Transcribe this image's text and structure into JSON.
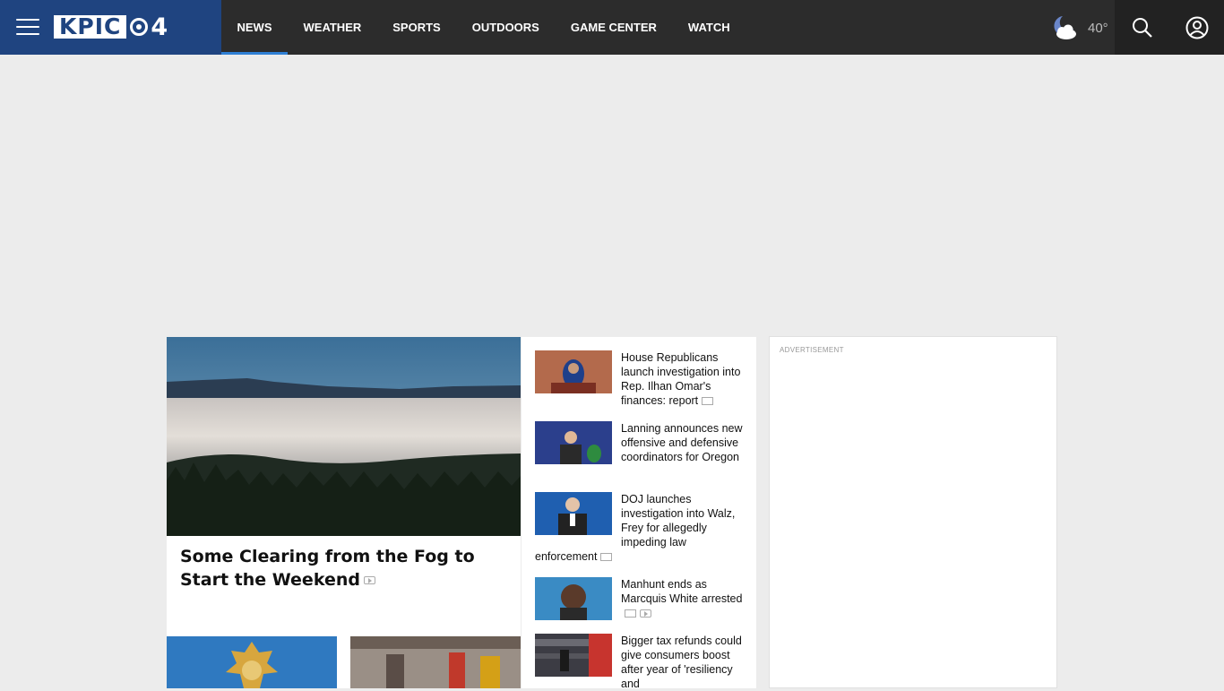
{
  "header": {
    "logo_text": "KPIC",
    "logo_number": "4",
    "nav": [
      {
        "label": "NEWS"
      },
      {
        "label": "WEATHER"
      },
      {
        "label": "SPORTS"
      },
      {
        "label": "OUTDOORS"
      },
      {
        "label": "GAME CENTER"
      },
      {
        "label": "WATCH"
      }
    ],
    "weather_temp": "40°",
    "weather_icon": "partly-cloudy-night-icon",
    "colors": {
      "logo_block": "#1f4480",
      "bar": "#2c2c2c",
      "active_underline": "#2f7fd4"
    }
  },
  "feature": {
    "headline": "Some Clearing from the Fog to Start the Weekend",
    "media_icon": "video-icon"
  },
  "stories": [
    {
      "title": "House Republicans launch investigation into Rep. Ilhan Omar's finances: report",
      "icons": [
        "gallery-icon"
      ]
    },
    {
      "title": "Lanning announces new offensive and defensive coordinators for Oregon",
      "icons": []
    },
    {
      "title": "DOJ launches investigation into Walz, Frey for allegedly impeding law enforcement",
      "icons": [
        "gallery-icon"
      ]
    },
    {
      "title": "Manhunt ends as Marcquis White arrested",
      "icons": [
        "gallery-icon",
        "video-icon"
      ]
    },
    {
      "title": "Bigger tax refunds could give consumers boost after year of 'resiliency and",
      "icons": []
    }
  ],
  "ad": {
    "label": "ADVERTISEMENT"
  }
}
